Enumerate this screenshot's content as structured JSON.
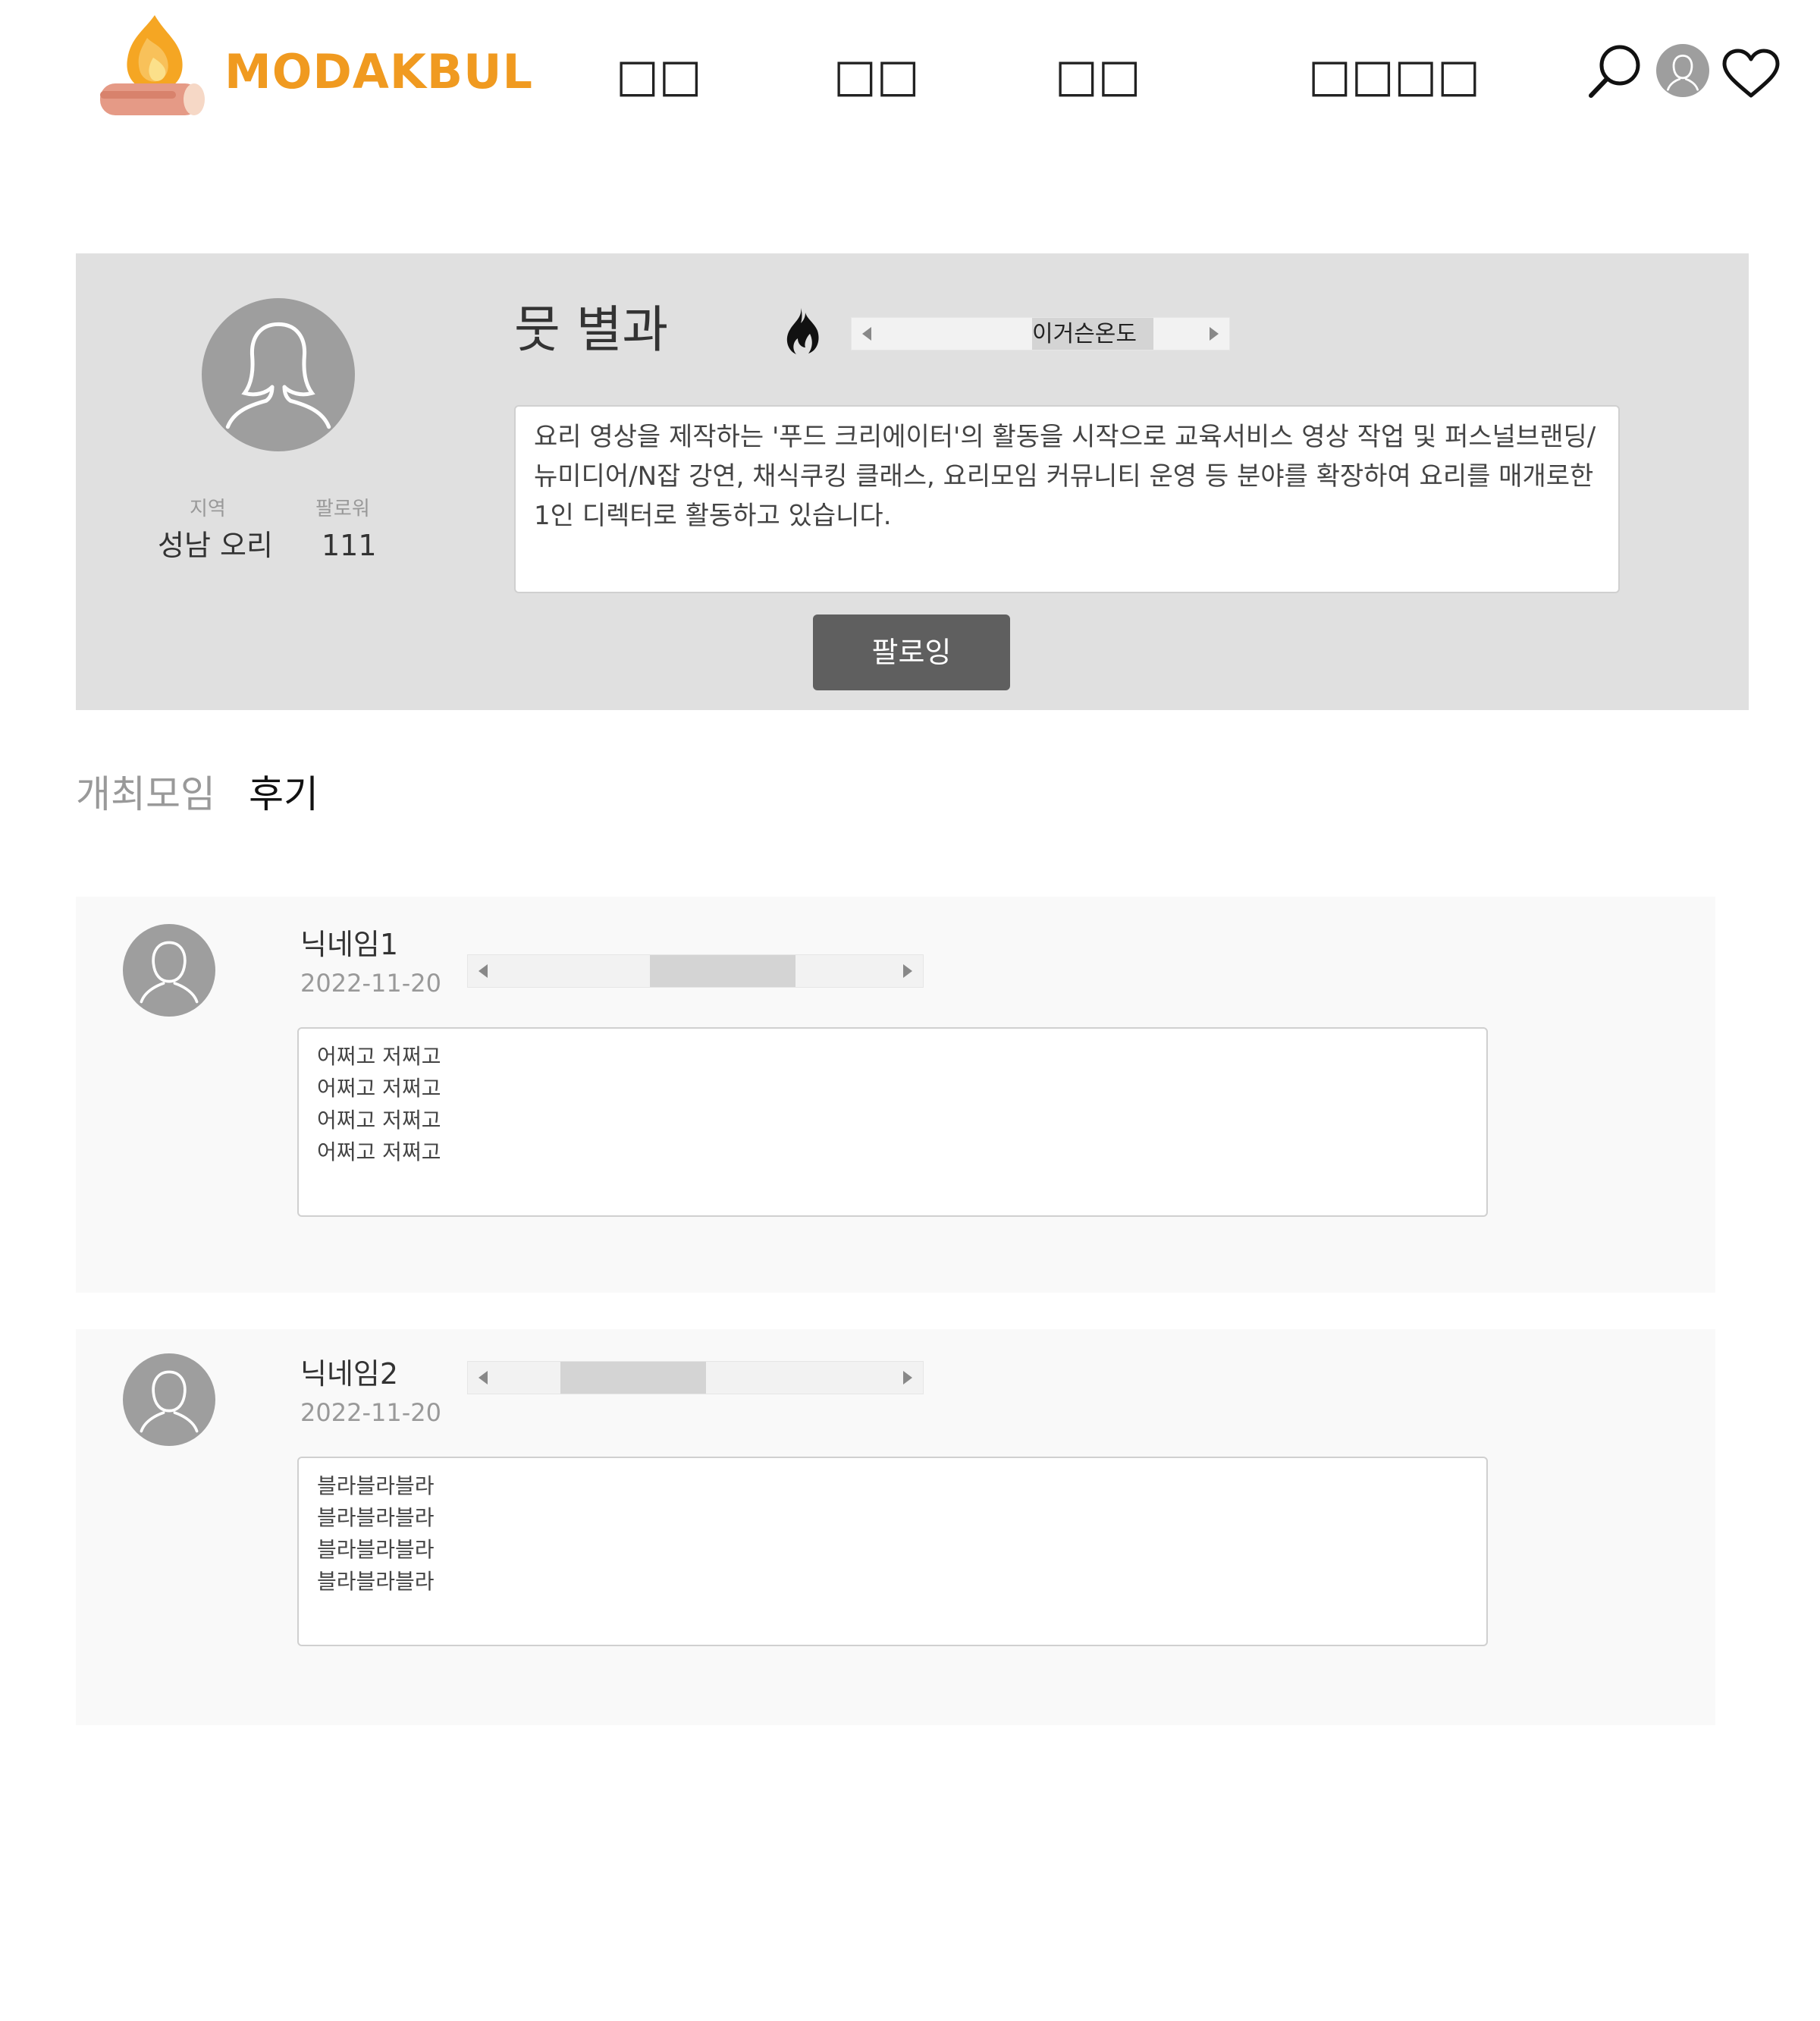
{
  "header": {
    "logo_text": "MODAKBUL",
    "nav": [
      "□□",
      "□□",
      "□□",
      "□□□□"
    ],
    "colors": {
      "brand": "#f09a20"
    },
    "icons": [
      "search-icon",
      "user-avatar-icon",
      "heart-icon"
    ]
  },
  "profile": {
    "name": "뭇 별과",
    "temperature_label": "이거슨온도",
    "temperature_level": 0.6,
    "region_label": "지역",
    "region_value": "성남 오리",
    "followers_label": "팔로워",
    "followers_value": "111",
    "bio": "요리 영상을 제작하는 '푸드 크리에이터'의 활동을 시작으로 교육서비스 영상 작업 및 퍼스널브랜딩/뉴미디어/N잡 강연, 채식쿠킹 클래스, 요리모임 커뮤니티 운영 등 분야를 확장하여 요리를 매개로한 1인 디렉터로 활동하고 있습니다.",
    "follow_button": "팔로잉"
  },
  "tabs": [
    {
      "label": "개최모임",
      "active": false
    },
    {
      "label": "후기",
      "active": true
    }
  ],
  "reviews": [
    {
      "nickname": "닉네임1",
      "date": "2022-11-20",
      "rating_level": 0.5,
      "lines": [
        "어쩌고 저쩌고",
        "어쩌고 저쩌고",
        "어쩌고 저쩌고",
        "어쩌고 저쩌고"
      ]
    },
    {
      "nickname": "닉네임2",
      "date": "2022-11-20",
      "rating_level": 0.3,
      "lines": [
        "블라블라블라",
        "블라블라블라",
        "블라블라블라",
        "블라블라블라"
      ]
    }
  ]
}
